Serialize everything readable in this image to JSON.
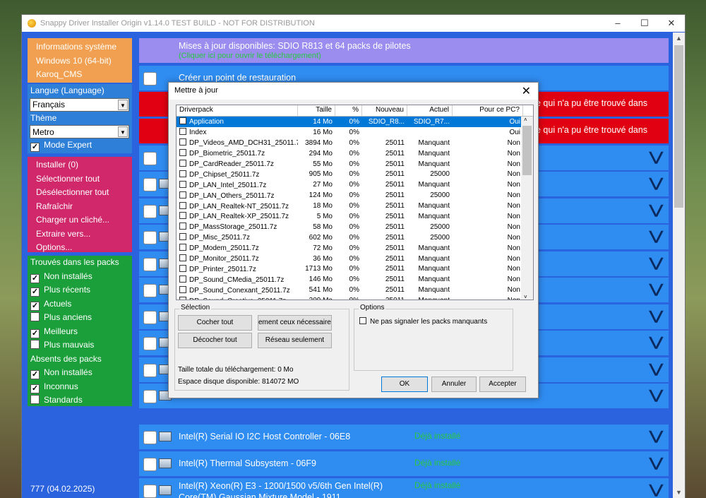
{
  "window": {
    "title": "Snappy Driver Installer Origin v1.14.0 TEST BUILD - NOT FOR DISTRIBUTION"
  },
  "system": {
    "line1": "Informations système",
    "line2": "Windows 10 (64-bit)",
    "line3": "Karoq_CMS"
  },
  "lang": {
    "label": "Langue (Language)",
    "value": "Français",
    "theme_label": "Thème",
    "theme_value": "Metro",
    "expert": "Mode Expert"
  },
  "actions": [
    "Installer (0)",
    "Sélectionner tout",
    "Désélectionner tout",
    "Rafraîchir",
    "Charger un cliché...",
    "Extraire vers...",
    "Options..."
  ],
  "filters": {
    "found_header": "Trouvés dans les packs",
    "found": [
      {
        "label": "Non installés",
        "checked": true
      },
      {
        "label": "Plus récents",
        "checked": true
      },
      {
        "label": "Actuels",
        "checked": true
      },
      {
        "label": "Plus anciens",
        "checked": false
      },
      {
        "label": "Meilleurs",
        "checked": true
      },
      {
        "label": "Plus mauvais",
        "checked": false
      }
    ],
    "missing_header": "Absents des packs",
    "missing": [
      {
        "label": "Non installés",
        "checked": true
      },
      {
        "label": "Inconnus",
        "checked": true
      },
      {
        "label": "Standards",
        "checked": false
      }
    ]
  },
  "version": "777 (04.02.2025)",
  "rows": {
    "update_text": "Mises à jour disponibles: SDIO R813 et 64 packs de pilotes",
    "update_sub": "(Cliquer ici pour ouvrir le téléchargement)",
    "restore": "Créer un point de restauration",
    "red_text": "e qui n'a pu être trouvé dans",
    "dev1": "Intel(R) Serial IO I2C Host Controller - 06E8",
    "dev2": "Intel(R) Thermal Subsystem - 06F9",
    "dev3a": "Intel(R) Xeon(R) E3 - 1200/1500 v5/6th Gen Intel(R)",
    "dev3b": "Core(TM) Gaussian Mixture Model - 1911",
    "installed": "Déjà installé"
  },
  "dialog": {
    "title": "Mettre à jour",
    "columns": [
      "Driverpack",
      "Taille",
      "%",
      "Nouveau",
      "Actuel",
      "Pour ce PC?"
    ],
    "items": [
      {
        "name": "Application",
        "size": "14 Mo",
        "pct": "0%",
        "new": "SDIO_R8...",
        "cur": "SDIO_R7...",
        "pc": "Oui"
      },
      {
        "name": "Index",
        "size": "16 Mo",
        "pct": "0%",
        "new": "",
        "cur": "",
        "pc": "Oui"
      },
      {
        "name": "DP_Videos_AMD_DCH31_25011.7z",
        "size": "3894 Mo",
        "pct": "0%",
        "new": "25011",
        "cur": "Manquant",
        "pc": "Non"
      },
      {
        "name": "DP_Biometric_25011.7z",
        "size": "294 Mo",
        "pct": "0%",
        "new": "25011",
        "cur": "Manquant",
        "pc": "Non"
      },
      {
        "name": "DP_CardReader_25011.7z",
        "size": "55 Mo",
        "pct": "0%",
        "new": "25011",
        "cur": "Manquant",
        "pc": "Non"
      },
      {
        "name": "DP_Chipset_25011.7z",
        "size": "905 Mo",
        "pct": "0%",
        "new": "25011",
        "cur": "25000",
        "pc": "Non"
      },
      {
        "name": "DP_LAN_Intel_25011.7z",
        "size": "27 Mo",
        "pct": "0%",
        "new": "25011",
        "cur": "Manquant",
        "pc": "Non"
      },
      {
        "name": "DP_LAN_Others_25011.7z",
        "size": "124 Mo",
        "pct": "0%",
        "new": "25011",
        "cur": "25000",
        "pc": "Non"
      },
      {
        "name": "DP_LAN_Realtek-NT_25011.7z",
        "size": "18 Mo",
        "pct": "0%",
        "new": "25011",
        "cur": "Manquant",
        "pc": "Non"
      },
      {
        "name": "DP_LAN_Realtek-XP_25011.7z",
        "size": "5 Mo",
        "pct": "0%",
        "new": "25011",
        "cur": "Manquant",
        "pc": "Non"
      },
      {
        "name": "DP_MassStorage_25011.7z",
        "size": "58 Mo",
        "pct": "0%",
        "new": "25011",
        "cur": "25000",
        "pc": "Non"
      },
      {
        "name": "DP_Misc_25011.7z",
        "size": "602 Mo",
        "pct": "0%",
        "new": "25011",
        "cur": "25000",
        "pc": "Non"
      },
      {
        "name": "DP_Modem_25011.7z",
        "size": "72 Mo",
        "pct": "0%",
        "new": "25011",
        "cur": "Manquant",
        "pc": "Non"
      },
      {
        "name": "DP_Monitor_25011.7z",
        "size": "36 Mo",
        "pct": "0%",
        "new": "25011",
        "cur": "Manquant",
        "pc": "Non"
      },
      {
        "name": "DP_Printer_25011.7z",
        "size": "1713 Mo",
        "pct": "0%",
        "new": "25011",
        "cur": "Manquant",
        "pc": "Non"
      },
      {
        "name": "DP_Sound_CMedia_25011.7z",
        "size": "146 Mo",
        "pct": "0%",
        "new": "25011",
        "cur": "Manquant",
        "pc": "Non"
      },
      {
        "name": "DP_Sound_Conexant_25011.7z",
        "size": "541 Mo",
        "pct": "0%",
        "new": "25011",
        "cur": "Manquant",
        "pc": "Non"
      },
      {
        "name": "DP_Sound_Creative_25011.7z",
        "size": "309 Mo",
        "pct": "0%",
        "new": "25011",
        "cur": "Manquant",
        "pc": "Non"
      }
    ],
    "selection_label": "Sélection",
    "check_all": "Cocher tout",
    "only_needed": "ement ceux nécessaires",
    "uncheck_all": "Décocher tout",
    "network_only": "Réseau seulement",
    "total_size": "Taille totale du téléchargement: 0 Mo",
    "disk_space": "Espace disque disponible: 814072 MO",
    "options_label": "Options",
    "no_report": "Ne pas signaler les packs manquants",
    "ok": "OK",
    "cancel": "Annuler",
    "accept": "Accepter"
  }
}
